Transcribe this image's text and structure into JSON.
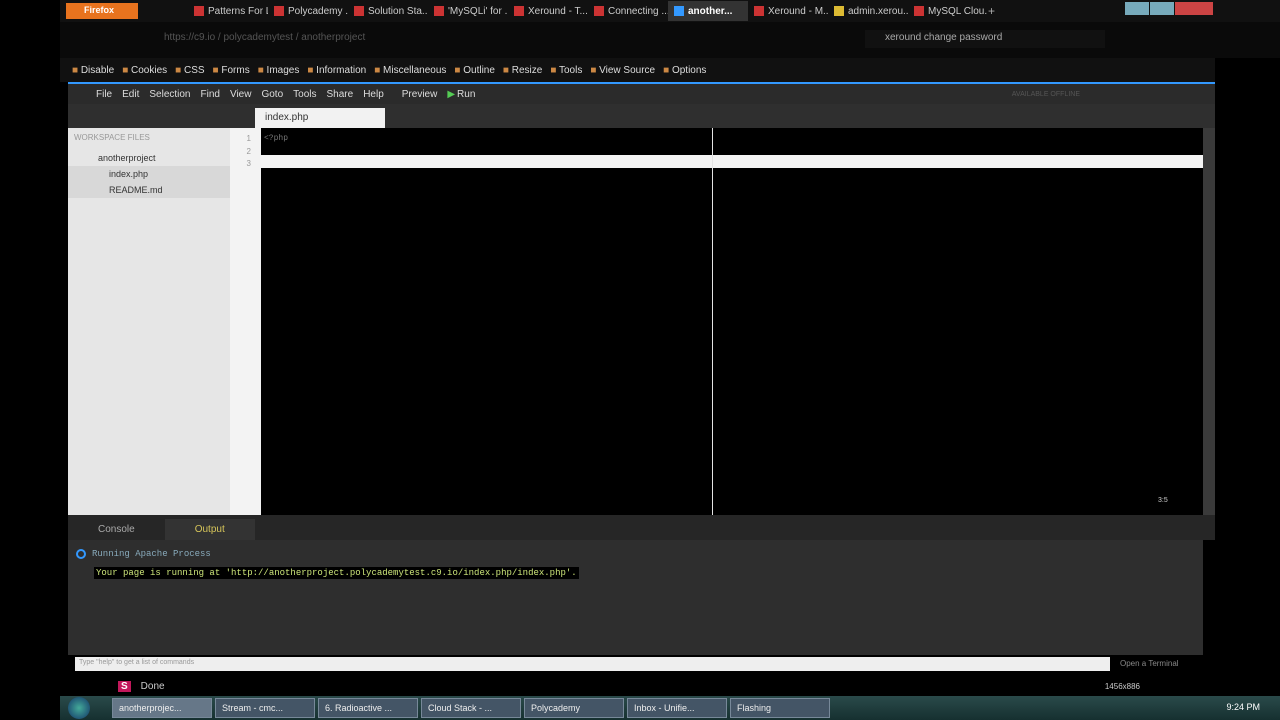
{
  "browser": {
    "menu_button": "Firefox",
    "tabs": [
      "Patterns For L...",
      "Polycademy ...",
      "Solution Sta...",
      "'MySQLi' for ...",
      "Xeround - T...",
      "Connecting ...",
      "another...",
      "Xeround - M...",
      "admin.xerou...",
      "MySQL Clou..."
    ],
    "active_tab": 6,
    "url": "https://c9.io / polycademytest / anotherproject",
    "search": "xeround change password"
  },
  "devbar": [
    "Disable",
    "Cookies",
    "CSS",
    "Forms",
    "Images",
    "Information",
    "Miscellaneous",
    "Outline",
    "Resize",
    "Tools",
    "View Source",
    "Options"
  ],
  "menu": [
    "File",
    "Edit",
    "Selection",
    "Find",
    "View",
    "Goto",
    "Tools",
    "Share",
    "Help",
    "Preview",
    "Run"
  ],
  "offline": "AVAILABLE OFFLINE",
  "editor_tab": "index.php",
  "sidebar": {
    "header": "WORKSPACE FILES",
    "folder": "anotherproject",
    "files": [
      "index.php",
      "README.md"
    ]
  },
  "editor": {
    "lines": [
      "<?php",
      "",
      ""
    ],
    "line_numbers": [
      "1",
      "2",
      "3"
    ],
    "position": "3:5"
  },
  "console": {
    "tabs": [
      "Console",
      "Output"
    ],
    "process": "Running Apache Process",
    "message": "Your page is running at 'http://anotherproject.polycademytest.c9.io/index.php/index.php'.",
    "cmd_placeholder": "Type \"help\" to get a list of commands",
    "open_terminal": "Open a Terminal"
  },
  "status": {
    "text": "Done",
    "resolution": "1456x886"
  },
  "taskbar": {
    "items": [
      "anotherprojec...",
      "Stream - cmc...",
      "6. Radioactive ...",
      "Cloud Stack - ...",
      "Polycademy",
      "Inbox - Unifie...",
      "Flashing"
    ],
    "clock": "9:24 PM"
  }
}
